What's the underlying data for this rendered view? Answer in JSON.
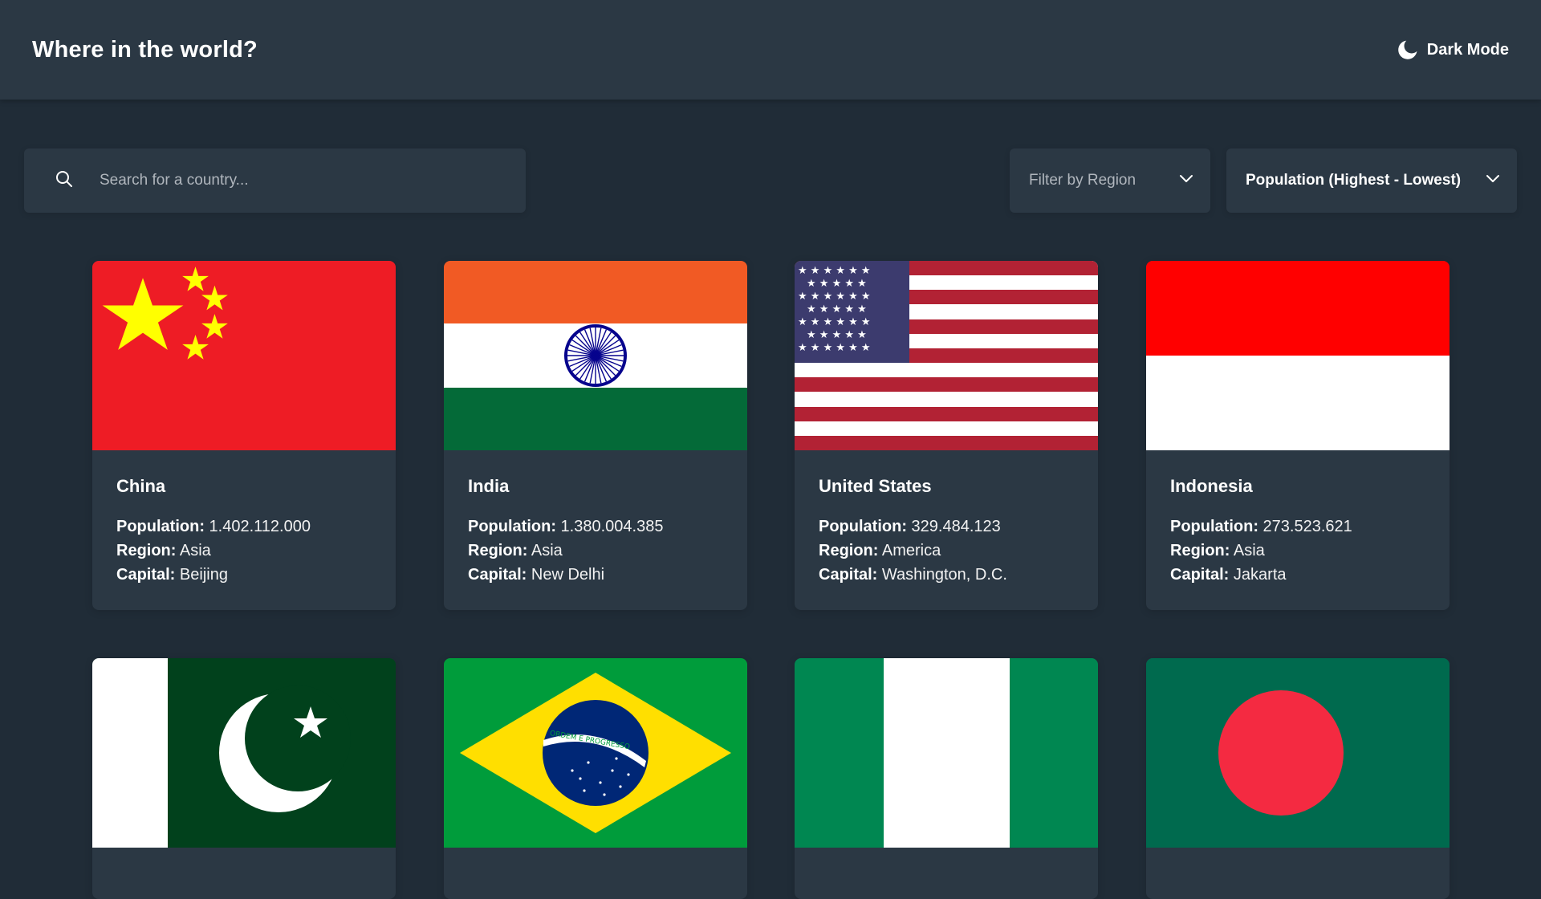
{
  "header": {
    "title": "Where in the world?",
    "theme_toggle_label": "Dark Mode",
    "theme_icon": "moon-icon"
  },
  "search": {
    "placeholder": "Search for a country...",
    "value": "",
    "icon": "search-icon"
  },
  "filters": {
    "region_label": "Filter by Region",
    "sort_label": "Population (Highest - Lowest)",
    "chevron_icon": "chevron-down-icon"
  },
  "stat_labels": {
    "population": "Population:",
    "region": "Region:",
    "capital": "Capital:"
  },
  "countries": [
    {
      "name": "China",
      "population": "1.402.112.000",
      "region": "Asia",
      "capital": "Beijing",
      "flag": "china-flag"
    },
    {
      "name": "India",
      "population": "1.380.004.385",
      "region": "Asia",
      "capital": "New Delhi",
      "flag": "india-flag"
    },
    {
      "name": "United States",
      "population": "329.484.123",
      "region": "America",
      "capital": "Washington, D.C.",
      "flag": "usa-flag"
    },
    {
      "name": "Indonesia",
      "population": "273.523.621",
      "region": "Asia",
      "capital": "Jakarta",
      "flag": "indonesia-flag"
    },
    {
      "flag": "pakistan-flag"
    },
    {
      "flag": "brazil-flag",
      "flag_text": "ORDEM E PROGRESSO"
    },
    {
      "flag": "nigeria-flag"
    },
    {
      "flag": "bangladesh-flag"
    }
  ],
  "colors": {
    "background": "#202c37",
    "surface": "#2b3844",
    "text": "#ffffff",
    "muted_text": "#b0b6bd"
  }
}
